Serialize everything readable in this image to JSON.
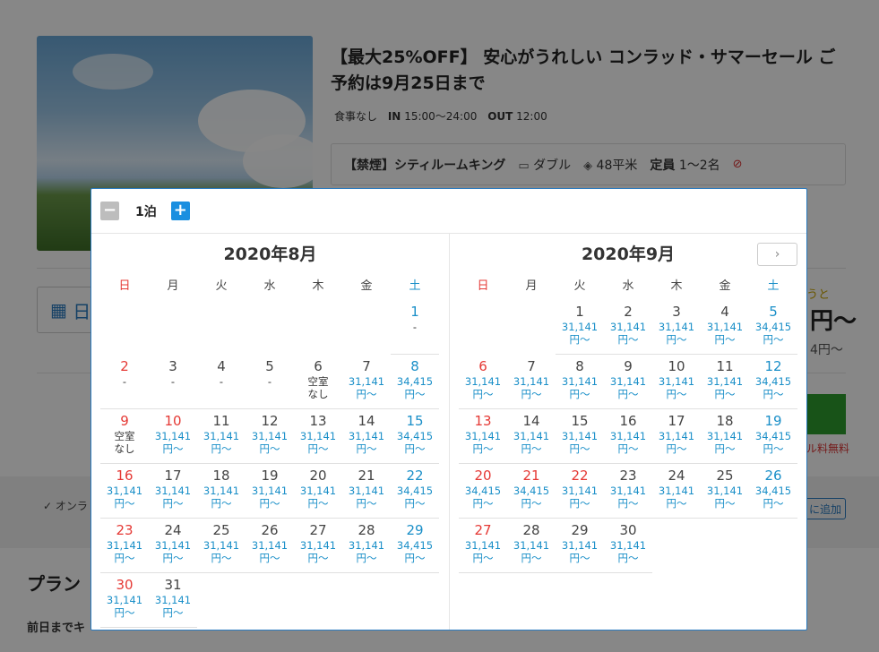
{
  "page": {
    "plan_title": "【最大25%OFF】 安心がうれしい コンラッド・サマーセール ご予約は9月25日まで",
    "meal": "食事なし",
    "in_label": "IN",
    "in_time": "15:00〜24:00",
    "out_label": "OUT",
    "out_time": "12:00",
    "room_name": "【禁煙】シティルームキング",
    "bed": "ダブル",
    "area": "48平米",
    "capacity_label": "定員",
    "capacity": "1〜2名",
    "date_box": "日",
    "right_note": "うと",
    "price_big": "円〜",
    "price_small": "4円〜",
    "cancel_free": "ル料無料",
    "online_tag": "✓ オンラ",
    "add_btn": "に追加",
    "plan_heading": "プラン",
    "bottom_text": "前日までキ"
  },
  "popup": {
    "nights_label": "1泊",
    "minus": "−",
    "plus": "+",
    "next": "›",
    "weekdays": [
      "日",
      "月",
      "火",
      "水",
      "木",
      "金",
      "土"
    ],
    "months": [
      {
        "title": "2020年8月",
        "cells": [
          {
            "d": ""
          },
          {
            "d": ""
          },
          {
            "d": ""
          },
          {
            "d": ""
          },
          {
            "d": ""
          },
          {
            "d": ""
          },
          {
            "d": "1",
            "s": "-"
          },
          {
            "d": "2",
            "s": "-"
          },
          {
            "d": "3",
            "s": "-"
          },
          {
            "d": "4",
            "s": "-"
          },
          {
            "d": "5",
            "s": "-"
          },
          {
            "d": "6",
            "s": "空室",
            "s2": "なし"
          },
          {
            "d": "7",
            "p": "31,141"
          },
          {
            "d": "8",
            "p": "34,415"
          },
          {
            "d": "9",
            "s": "空室",
            "s2": "なし"
          },
          {
            "d": "10",
            "p": "31,141",
            "hol": true
          },
          {
            "d": "11",
            "p": "31,141"
          },
          {
            "d": "12",
            "p": "31,141"
          },
          {
            "d": "13",
            "p": "31,141"
          },
          {
            "d": "14",
            "p": "31,141"
          },
          {
            "d": "15",
            "p": "34,415"
          },
          {
            "d": "16",
            "p": "31,141"
          },
          {
            "d": "17",
            "p": "31,141"
          },
          {
            "d": "18",
            "p": "31,141"
          },
          {
            "d": "19",
            "p": "31,141"
          },
          {
            "d": "20",
            "p": "31,141"
          },
          {
            "d": "21",
            "p": "31,141"
          },
          {
            "d": "22",
            "p": "34,415"
          },
          {
            "d": "23",
            "p": "31,141"
          },
          {
            "d": "24",
            "p": "31,141"
          },
          {
            "d": "25",
            "p": "31,141"
          },
          {
            "d": "26",
            "p": "31,141"
          },
          {
            "d": "27",
            "p": "31,141"
          },
          {
            "d": "28",
            "p": "31,141"
          },
          {
            "d": "29",
            "p": "34,415"
          },
          {
            "d": "30",
            "p": "31,141"
          },
          {
            "d": "31",
            "p": "31,141"
          }
        ]
      },
      {
        "title": "2020年9月",
        "cells": [
          {
            "d": ""
          },
          {
            "d": ""
          },
          {
            "d": "1",
            "p": "31,141"
          },
          {
            "d": "2",
            "p": "31,141"
          },
          {
            "d": "3",
            "p": "31,141"
          },
          {
            "d": "4",
            "p": "31,141"
          },
          {
            "d": "5",
            "p": "34,415"
          },
          {
            "d": "6",
            "p": "31,141"
          },
          {
            "d": "7",
            "p": "31,141"
          },
          {
            "d": "8",
            "p": "31,141"
          },
          {
            "d": "9",
            "p": "31,141"
          },
          {
            "d": "10",
            "p": "31,141"
          },
          {
            "d": "11",
            "p": "31,141"
          },
          {
            "d": "12",
            "p": "34,415"
          },
          {
            "d": "13",
            "p": "31,141"
          },
          {
            "d": "14",
            "p": "31,141"
          },
          {
            "d": "15",
            "p": "31,141"
          },
          {
            "d": "16",
            "p": "31,141"
          },
          {
            "d": "17",
            "p": "31,141"
          },
          {
            "d": "18",
            "p": "31,141"
          },
          {
            "d": "19",
            "p": "34,415"
          },
          {
            "d": "20",
            "p": "34,415"
          },
          {
            "d": "21",
            "p": "34,415",
            "hol": true
          },
          {
            "d": "22",
            "p": "31,141",
            "hol": true
          },
          {
            "d": "23",
            "p": "31,141"
          },
          {
            "d": "24",
            "p": "31,141"
          },
          {
            "d": "25",
            "p": "31,141"
          },
          {
            "d": "26",
            "p": "34,415"
          },
          {
            "d": "27",
            "p": "31,141"
          },
          {
            "d": "28",
            "p": "31,141"
          },
          {
            "d": "29",
            "p": "31,141"
          },
          {
            "d": "30",
            "p": "31,141"
          }
        ]
      }
    ],
    "price_suffix": "円〜",
    "colors": {
      "accent": "#1a8fc8",
      "sunday": "#e53935",
      "border": "#2a7bc0"
    }
  }
}
